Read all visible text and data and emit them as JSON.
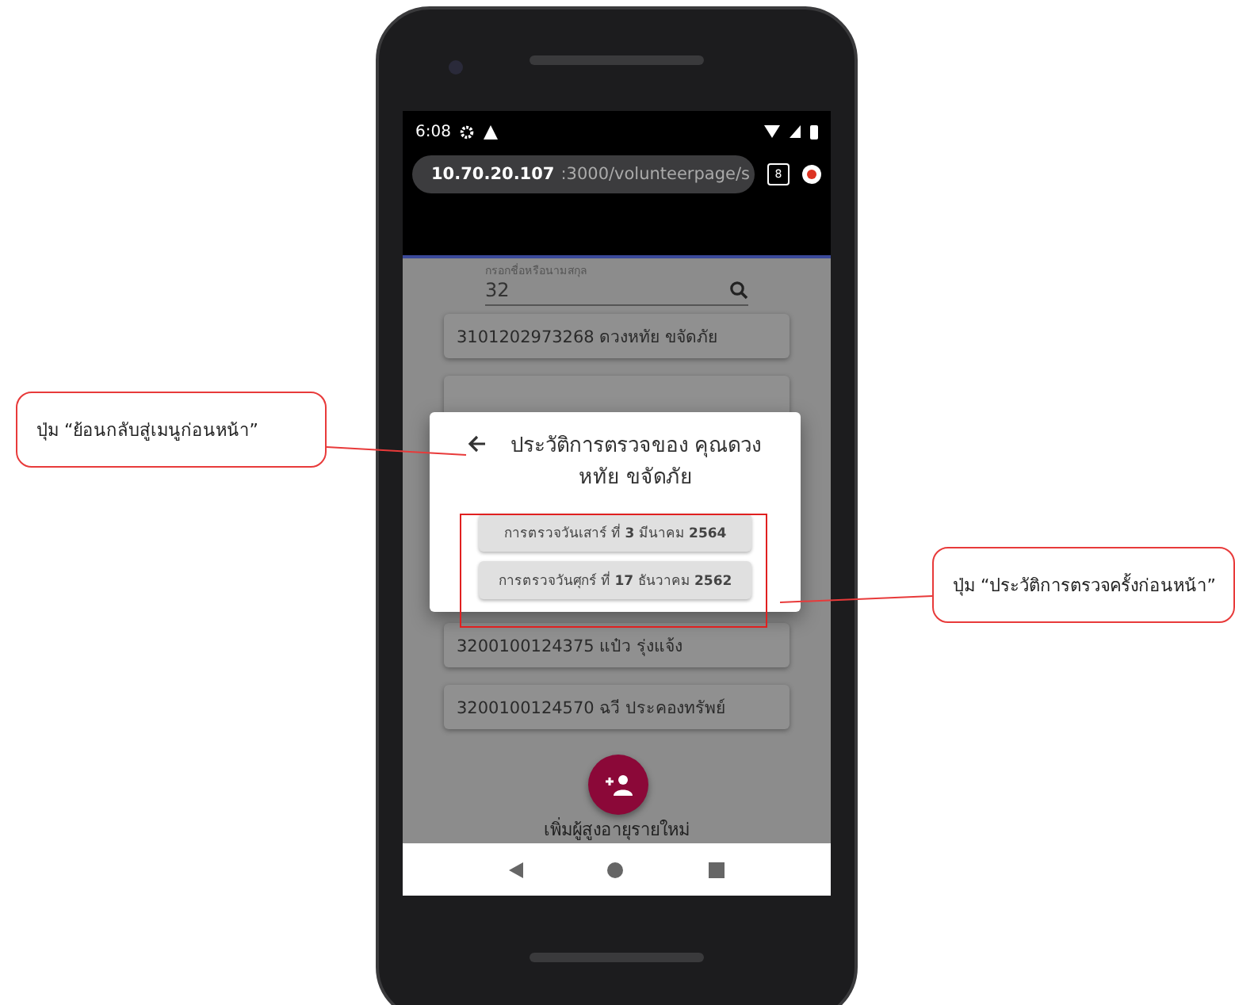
{
  "status_bar": {
    "time": "6:08"
  },
  "browser": {
    "url_host": "10.70.20.107",
    "url_rest": ":3000/volunteerpage/s",
    "tab_count": "8"
  },
  "search": {
    "label": "กรอกชื่อหรือนามสกุล",
    "value": "32"
  },
  "rows_top": [
    {
      "text": "3101202973268 ดวงหทัย ขจัดภัย"
    }
  ],
  "rows_bottom": [
    {
      "text": "3200100124375 แป๋ว รุ่งแจ้ง"
    },
    {
      "text": "3200100124570 ฉวี ประคองทรัพย์"
    }
  ],
  "fab": {
    "label": "เพิ่มผู้สูงอายุรายใหม่"
  },
  "dialog": {
    "title": "ประวัติการตรวจของ คุณดวงหทัย ขจัดภัย",
    "buttons": [
      {
        "text": "การตรวจวันเสาร์ ที่ **3** มีนาคม **2564**"
      },
      {
        "text": "การตรวจวันศุกร์ ที่ **17** ธันวาคม **2562**"
      }
    ]
  },
  "callouts": [
    {
      "kind": "left",
      "text": "ปุ่ม “ย้อนกลับสู่เมนูก่อนหน้า”"
    },
    {
      "kind": "right",
      "text": "ปุ่ม “ประวัติการตรวจครั้งก่อนหน้า”"
    }
  ]
}
